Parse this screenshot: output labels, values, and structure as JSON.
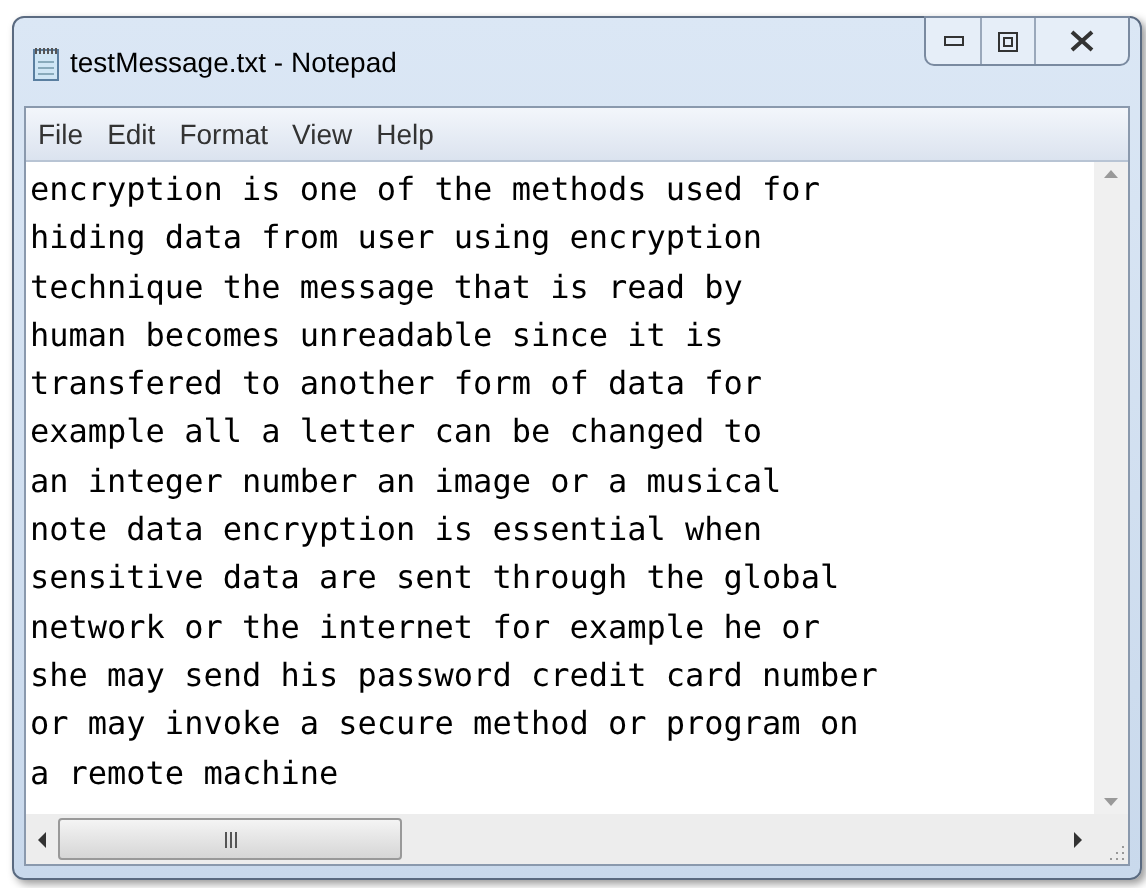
{
  "window": {
    "title": "testMessage.txt - Notepad"
  },
  "menu": [
    "File",
    "Edit",
    "Format",
    "View",
    "Help"
  ],
  "document": {
    "text": "encryption is one of the methods used for\nhiding data from user using encryption\ntechnique the message that is read by\nhuman becomes unreadable since it is\ntransfered to another form of data for\nexample all a letter can be changed to\nan integer number an image or a musical\nnote data encryption is essential when\nsensitive data are sent through the global\nnetwork or the internet for example he or\nshe may send his password credit card number\nor may invoke a secure method or program on\na remote machine"
  }
}
